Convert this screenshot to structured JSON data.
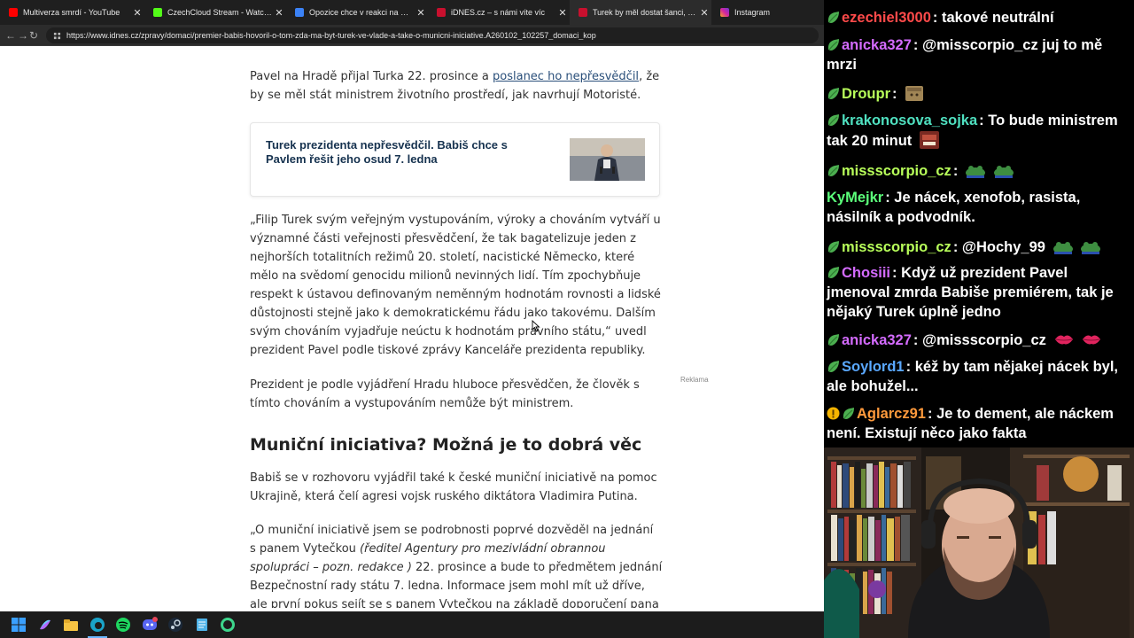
{
  "browser": {
    "tabs": [
      {
        "title": "Multiverza smrdí - YouTube",
        "favicon_color": "#ff0000",
        "active": false
      },
      {
        "title": "CzechCloud Stream - Watch Live o",
        "favicon_color": "#53fc18",
        "active": false
      },
      {
        "title": "Opozice chce v reakci na Okamur",
        "favicon_color": "#3b82f6",
        "active": false
      },
      {
        "title": "iDNES.cz – s námi víte víc",
        "favicon_color": "#c8102e",
        "active": false
      },
      {
        "title": "Turek by měl dostat šanci, říká Bab",
        "favicon_color": "#c8102e",
        "active": true
      },
      {
        "title": "Instagram",
        "favicon_color": "#d6249f",
        "active": false
      }
    ],
    "close_glyph": "✕",
    "back_glyph": "←",
    "forward_glyph": "→",
    "reload_glyph": "↻",
    "url": "https://www.idnes.cz/zpravy/domaci/premier-babis-hovoril-o-tom-zda-ma-byt-turek-ve-vlade-a-take-o-municni-iniciative.A260102_102257_domaci_kop"
  },
  "article": {
    "p1_before_link": "Pavel na Hradě přijal Turka 22. prosince a ",
    "p1_link": "poslanec ho nepřesvědčil",
    "p1_after_link": ", že by se měl stát ministrem životního prostředí, jak navrhují Motoristé.",
    "related_title": "Turek prezidenta nepřesvědčil. Babiš chce s Pavlem řešit jeho osud 7. ledna",
    "p2": "„Filip Turek svým veřejným vystupováním, výroky a chováním vytváří u významné části veřejnosti přesvědčení, že tak bagatelizuje jeden z nejhorších totalitních režimů 20. století, nacistické Německo, které mělo na svědomí genocidu milionů nevinných lidí. Tím zpochybňuje respekt k ústavou definovaným neměnným hodnotám rovnosti a lidské důstojnosti stejně jako k demokratickému řádu jako takovému. Dalším svým chováním vyjadřuje neúctu k hodnotám právního státu,“ uvedl prezident Pavel podle tiskové zprávy Kanceláře prezidenta republiky.",
    "p3": "Prezident je podle vyjádření Hradu hluboce přesvědčen, že člověk s tímto chováním a vystupováním nemůže být ministrem.",
    "heading": "Muniční iniciativa? Možná je to dobrá věc",
    "p4": "Babiš se v rozhovoru vyjádřil také k české muniční iniciativě na pomoc Ukrajině, která čelí agresi vojsk ruského diktátora Vladimira Putina.",
    "p5_before_italic": "„O muniční iniciativě jsem se podrobnosti poprvé dozvěděl na jednání s panem Vytečkou ",
    "p5_italic": "(ředitel Agentury pro mezivládní obrannou spolupráci – pozn. redakce )",
    "p5_after_italic": " 22. prosince a bude to předmětem jednání Bezpečnostní rady státu 7. ledna. Informace jsem mohl mít už dříve, ale první pokus sejít se s panem Vytečkou na základě doporučení pana prezidenta nedopadl",
    "ad_label": "Reklama"
  },
  "chat": {
    "messages": [
      {
        "user": "ezechiel3000",
        "user_color": "#ff4a4a",
        "text": "takové neutrální",
        "badges": [
          "green-leaf-badge"
        ],
        "emotes": []
      },
      {
        "user": "anicka327",
        "user_color": "#d46bff",
        "text": "@misscorpio_cz juj to mě mrzi",
        "badges": [
          "green-leaf-badge"
        ],
        "emotes": []
      },
      {
        "user": "Droupr",
        "user_color": "#b8ff5a",
        "text": "",
        "badges": [
          "green-leaf-badge"
        ],
        "emotes": [
          "box-emote"
        ]
      },
      {
        "user": "krakonosova_sojka",
        "user_color": "#4fe0c0",
        "text": "To bude ministrem tak 20 minut",
        "badges": [
          "green-leaf-badge"
        ],
        "emotes": [
          "face-emote"
        ]
      },
      {
        "user": "missscorpio_cz",
        "user_color": "#b8ff5a",
        "text": "",
        "badges": [
          "green-leaf-badge"
        ],
        "emotes": [
          "frog-emote",
          "frog-emote"
        ]
      },
      {
        "user": "KyMejkr",
        "user_color": "#5bff7a",
        "text": "Je nácek, xenofob, rasista, násilník a podvodník.",
        "badges": [],
        "emotes": []
      },
      {
        "user": "missscorpio_cz",
        "user_color": "#b8ff5a",
        "text": "@Hochy_99",
        "badges": [
          "green-leaf-badge"
        ],
        "emotes": [
          "frog-emote",
          "frog-emote"
        ]
      },
      {
        "user": "Chosiii",
        "user_color": "#d46bff",
        "text": "Když už prezident Pavel jmenoval zmrda Babiše premiérem, tak je nějaký Turek úplně jedno",
        "badges": [
          "green-leaf-badge"
        ],
        "emotes": []
      },
      {
        "user": "anicka327",
        "user_color": "#d46bff",
        "text": "@missscorpio_cz",
        "badges": [
          "green-leaf-badge"
        ],
        "emotes": [
          "lips-emote",
          "lips-emote"
        ]
      },
      {
        "user": "Soylord1",
        "user_color": "#5aa8ff",
        "text": "kéž by tam nějakej nácek byl, ale bohužel...",
        "badges": [
          "green-leaf-badge"
        ],
        "emotes": []
      },
      {
        "user": "Aglarcz91",
        "user_color": "#ff9a3c",
        "text": "Je to dement, ale náckem není. Existují něco jako fakta",
        "badges": [
          "gold-badge",
          "green-leaf-badge"
        ],
        "emotes": []
      }
    ]
  }
}
